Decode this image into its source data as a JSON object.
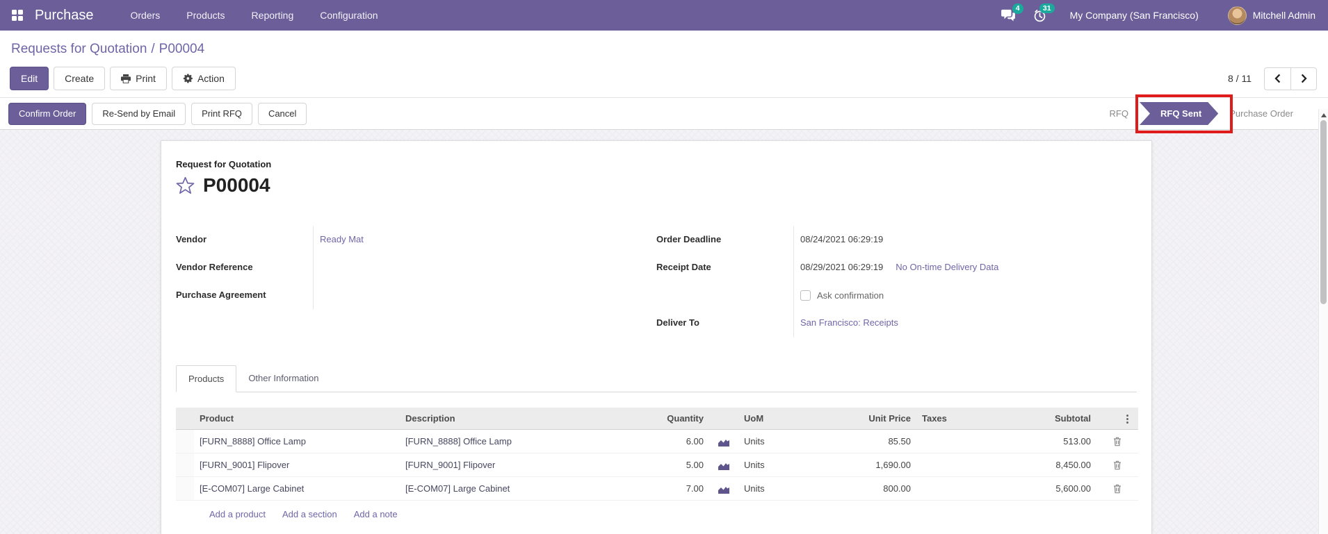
{
  "navbar": {
    "app_name": "Purchase",
    "menus": [
      "Orders",
      "Products",
      "Reporting",
      "Configuration"
    ],
    "messages_badge": "4",
    "activities_badge": "31",
    "company": "My Company (San Francisco)",
    "user": "Mitchell Admin"
  },
  "breadcrumb": {
    "parent": "Requests for Quotation",
    "sep": "/",
    "current": "P00004"
  },
  "control_panel": {
    "edit": "Edit",
    "create": "Create",
    "print": "Print",
    "action": "Action",
    "pager": "8 / 11"
  },
  "statusbar": {
    "buttons": [
      "Confirm Order",
      "Re-Send by Email",
      "Print RFQ",
      "Cancel"
    ],
    "states": [
      {
        "label": "RFQ",
        "active": false
      },
      {
        "label": "RFQ Sent",
        "active": true
      },
      {
        "label": "Purchase Order",
        "active": false
      }
    ],
    "annotation": "red box highlighting RFQ Sent state"
  },
  "form": {
    "header_label": "Request for Quotation",
    "name": "P00004",
    "vendor": {
      "label": "Vendor",
      "value": "Ready Mat"
    },
    "vendor_reference": {
      "label": "Vendor Reference",
      "value": ""
    },
    "purchase_agreement": {
      "label": "Purchase Agreement",
      "value": ""
    },
    "order_deadline": {
      "label": "Order Deadline",
      "value": "08/24/2021 06:29:19"
    },
    "receipt_date": {
      "label": "Receipt Date",
      "value": "08/29/2021 06:29:19",
      "link": "No On-time Delivery Data"
    },
    "ask_confirmation": {
      "label": "Ask confirmation",
      "checked": false
    },
    "deliver_to": {
      "label": "Deliver To",
      "value": "San Francisco: Receipts"
    }
  },
  "tabs": [
    "Products",
    "Other Information"
  ],
  "table": {
    "headers": {
      "product": "Product",
      "description": "Description",
      "quantity": "Quantity",
      "uom": "UoM",
      "unit_price": "Unit Price",
      "taxes": "Taxes",
      "subtotal": "Subtotal"
    },
    "rows": [
      {
        "product": "[FURN_8888] Office Lamp",
        "description": "[FURN_8888] Office Lamp",
        "quantity": "6.00",
        "uom": "Units",
        "unit_price": "85.50",
        "taxes": "",
        "subtotal": "513.00"
      },
      {
        "product": "[FURN_9001] Flipover",
        "description": "[FURN_9001] Flipover",
        "quantity": "5.00",
        "uom": "Units",
        "unit_price": "1,690.00",
        "taxes": "",
        "subtotal": "8,450.00"
      },
      {
        "product": "[E-COM07] Large Cabinet",
        "description": "[E-COM07] Large Cabinet",
        "quantity": "7.00",
        "uom": "Units",
        "unit_price": "800.00",
        "taxes": "",
        "subtotal": "5,600.00"
      }
    ],
    "footer_links": [
      "Add a product",
      "Add a section",
      "Add a note"
    ]
  },
  "icons": {
    "apps": "apps-grid-icon",
    "messages": "chat-bubbles-icon",
    "activities": "clock-icon",
    "print": "printer-icon",
    "action": "gear-icon",
    "pager_prev": "chevron-left-icon",
    "pager_next": "chevron-right-icon",
    "favorite": "star-icon",
    "forecast": "area-chart-icon",
    "delete": "trash-icon",
    "row_menu": "kebab-icon",
    "scroll_up": "arrow-up-icon"
  },
  "colors": {
    "primary": "#6b5e99",
    "link": "#6f66a8",
    "badge": "#1ba99e",
    "annotation_red": "#e01b1b"
  }
}
